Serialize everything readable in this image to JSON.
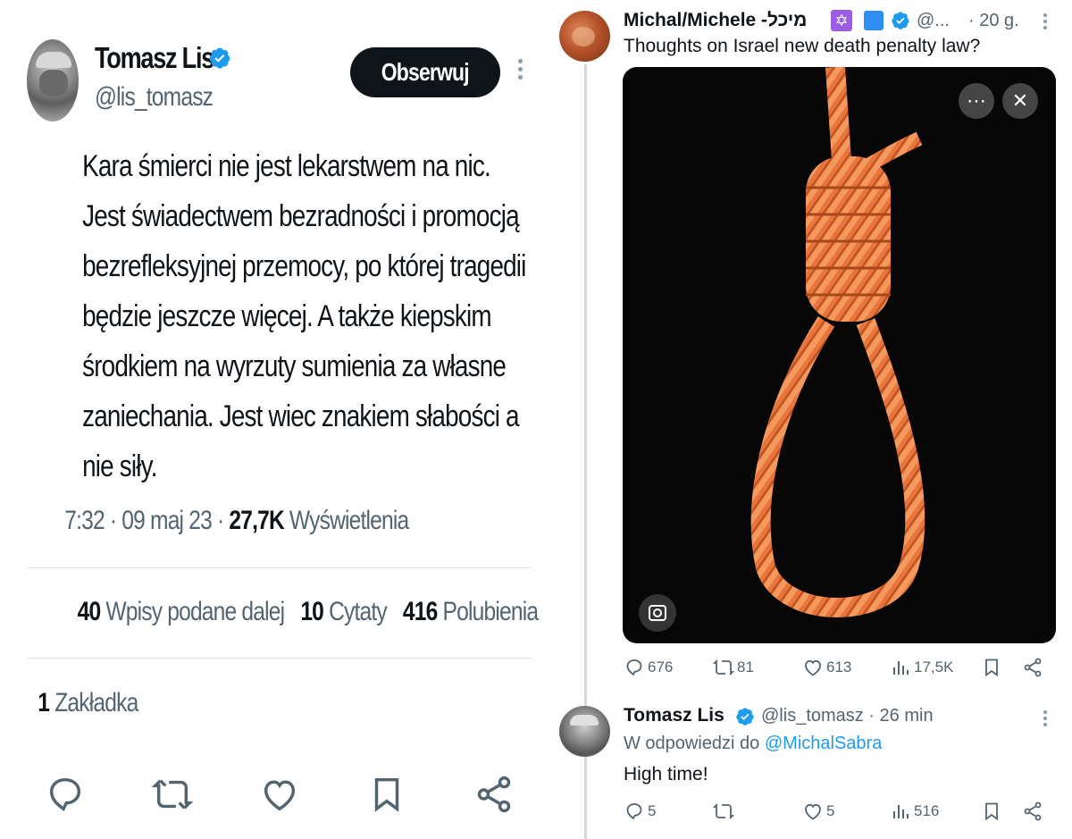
{
  "left_tweet": {
    "author_name": "Tomasz Lis",
    "author_handle": "@lis_tomasz",
    "follow_label": "Obserwuj",
    "text_lines": [
      "Kara śmierci nie jest lekarstwem na nic.",
      "Jest świadectwem bezradności i promocją",
      "bezrefleksyjnej przemocy, po której tragedii",
      "będzie jeszcze więcej. A także kiepskim",
      "środkiem na wyrzuty sumienia za własne",
      "zaniechania. Jest wiec znakiem słabości a",
      "nie siły."
    ],
    "time": "7:32",
    "date": "09 maj 23",
    "views_count": "27,7K",
    "views_label": "Wyświetlenia",
    "retweets_count": "40",
    "retweets_label": "Wpisy podane dalej",
    "quotes_count": "10",
    "quotes_label": "Cytaty",
    "likes_count": "416",
    "likes_label": "Polubienia",
    "bookmarks_count": "1",
    "bookmarks_label": "Zakładka"
  },
  "right_thread": {
    "post1": {
      "author_name": "Michal/Michele -מיכל",
      "star_emoji": "✡",
      "handle": "@...",
      "time": "· 20 g.",
      "text": "Thoughts on Israel new death penalty law?",
      "replies": "676",
      "retweets": "81",
      "likes": "613",
      "views": "17,5K"
    },
    "post2": {
      "author_name": "Tomasz Lis",
      "handle_time": "@lis_tomasz · 26 min",
      "reply_prefix": "W odpowiedzi do",
      "reply_to": "@MichalSabra",
      "text": "High time!",
      "replies": "5",
      "likes": "5",
      "views": "516"
    }
  },
  "colors": {
    "verified": "#1d9bf0",
    "muted": "#536471",
    "rope": "#e8763c"
  }
}
